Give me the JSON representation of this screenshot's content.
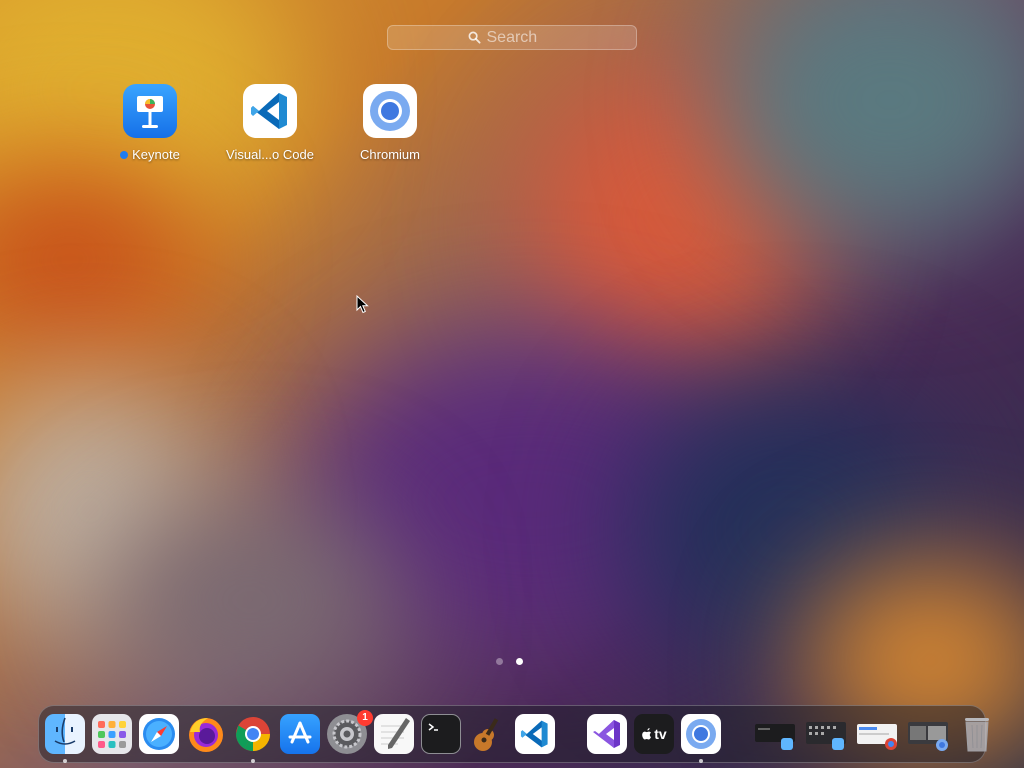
{
  "search": {
    "placeholder": "Search"
  },
  "apps": [
    {
      "name": "Keynote",
      "has_new_dot": true
    },
    {
      "name": "Visual...o Code"
    },
    {
      "name": "Chromium"
    }
  ],
  "page_indicator": {
    "pages": 2,
    "active_page": 2
  },
  "dock": {
    "apps": [
      {
        "icon": "finder-icon",
        "running": true
      },
      {
        "icon": "launchpad-icon",
        "running": false
      },
      {
        "icon": "safari-icon",
        "running": false
      },
      {
        "icon": "firefox-icon",
        "running": false
      },
      {
        "icon": "chrome-icon",
        "running": true
      },
      {
        "icon": "app-store-icon",
        "running": false
      },
      {
        "icon": "system-settings-icon",
        "running": false,
        "badge": "1"
      },
      {
        "icon": "textedit-icon",
        "running": false
      },
      {
        "icon": "terminal-icon",
        "running": false
      },
      {
        "icon": "instruments-icon",
        "running": false
      },
      {
        "icon": "vscode-icon",
        "running": false
      }
    ],
    "recent": [
      {
        "icon": "visual-studio-icon",
        "running": false
      },
      {
        "icon": "apple-tv-icon",
        "running": false,
        "label": "tv"
      },
      {
        "icon": "chromium-icon",
        "running": true
      }
    ],
    "windows": [
      {
        "icon": "minimized-window-finder-icon"
      },
      {
        "icon": "minimized-window-finder-2-icon"
      },
      {
        "icon": "minimized-window-chrome-icon"
      },
      {
        "icon": "minimized-window-chromium-icon"
      }
    ],
    "trash": {
      "icon": "trash-icon"
    }
  }
}
